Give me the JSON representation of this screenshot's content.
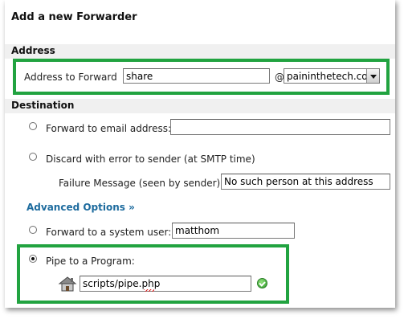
{
  "title": "Add a new Forwarder",
  "address": {
    "section_label": "Address",
    "forward_label": "Address to Forward",
    "forward_value": "share",
    "at_sign": "@",
    "domain_selected": "paininthetech.com"
  },
  "destination": {
    "section_label": "Destination",
    "forward_email_label": "Forward to email address:",
    "forward_email_value": "",
    "discard_label": "Discard with error to sender (at SMTP time)",
    "failure_label": "Failure Message (seen by sender):",
    "failure_value": "No such person at this address",
    "advanced_label": "Advanced Options »",
    "system_user_label": "Forward to a system user:",
    "system_user_value": "matthom",
    "pipe_label": "Pipe to a Program:",
    "pipe_value": "scripts/pipe.php",
    "selected_option": "pipe"
  },
  "colors": {
    "highlight_border": "#21a340",
    "link": "#1d6b9e",
    "section_bg": "#f0f0f0"
  },
  "icons": [
    "home-icon",
    "check-icon",
    "dropdown-arrow-icon"
  ]
}
